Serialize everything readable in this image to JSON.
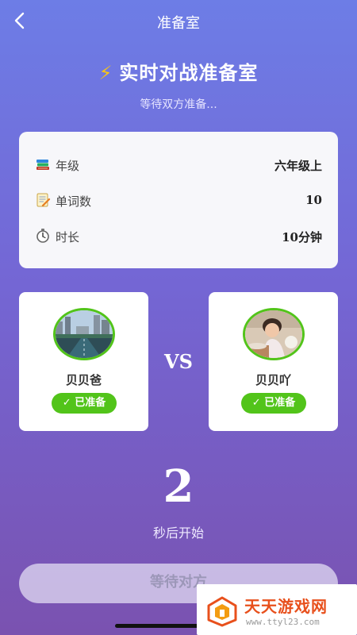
{
  "nav": {
    "title": "准备室"
  },
  "hero": {
    "icon": "⚡",
    "title": "实时对战准备室",
    "subtitle": "等待双方准备..."
  },
  "info": {
    "rows": [
      {
        "icon": "books-icon",
        "label": "年级",
        "value": "六年级上"
      },
      {
        "icon": "memo-icon",
        "label": "单词数",
        "value": "10"
      },
      {
        "icon": "stopwatch-icon",
        "label": "时长",
        "value": "10分钟"
      }
    ]
  },
  "players": [
    {
      "name": "贝贝爸",
      "status": "✓ 已准备"
    },
    {
      "name": "贝贝吖",
      "status": "✓ 已准备"
    }
  ],
  "vs_label": "VS",
  "countdown": {
    "number": "2",
    "label": "秒后开始"
  },
  "wait_button": {
    "label": "等待对方"
  },
  "watermark": {
    "title": "天天游戏网",
    "url": "www.ttyl23.com"
  },
  "colors": {
    "accent_green": "#52c41a",
    "gradient_top": "#6d7de6",
    "gradient_bottom": "#7a52b0",
    "watermark_orange": "#e8501c"
  }
}
